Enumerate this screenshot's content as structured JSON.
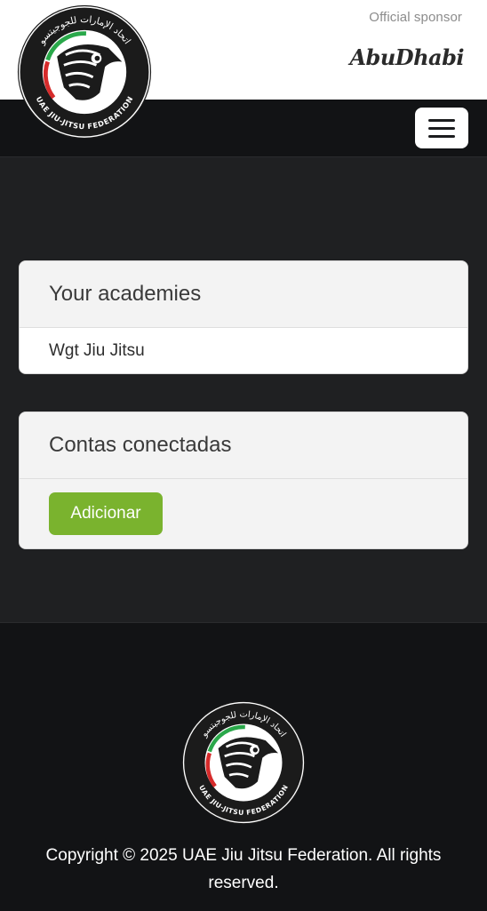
{
  "header": {
    "logo_arabic": "اتحاد الإمارات للجوجيتسو",
    "logo_english": "UAE JIU-JITSU FEDERATION",
    "sponsor_label": "Official sponsor",
    "sponsor_brand": "AbuDhabi",
    "menu_icon": "hamburger-icon"
  },
  "academies": {
    "title": "Your academies",
    "items": [
      "Wgt Jiu Jitsu"
    ]
  },
  "connected": {
    "title": "Contas conectadas",
    "add_label": "Adicionar"
  },
  "footer": {
    "logo_arabic": "اتحاد الإمارات للجوجيتسو",
    "logo_english": "UAE JIU-JITSU FEDERATION",
    "copyright": "Copyright © 2025 UAE Jiu Jitsu Federation. All rights reserved."
  },
  "colors": {
    "accent_green": "#7ab32e",
    "dark_bg": "#121315",
    "page_bg": "#1f2022"
  }
}
